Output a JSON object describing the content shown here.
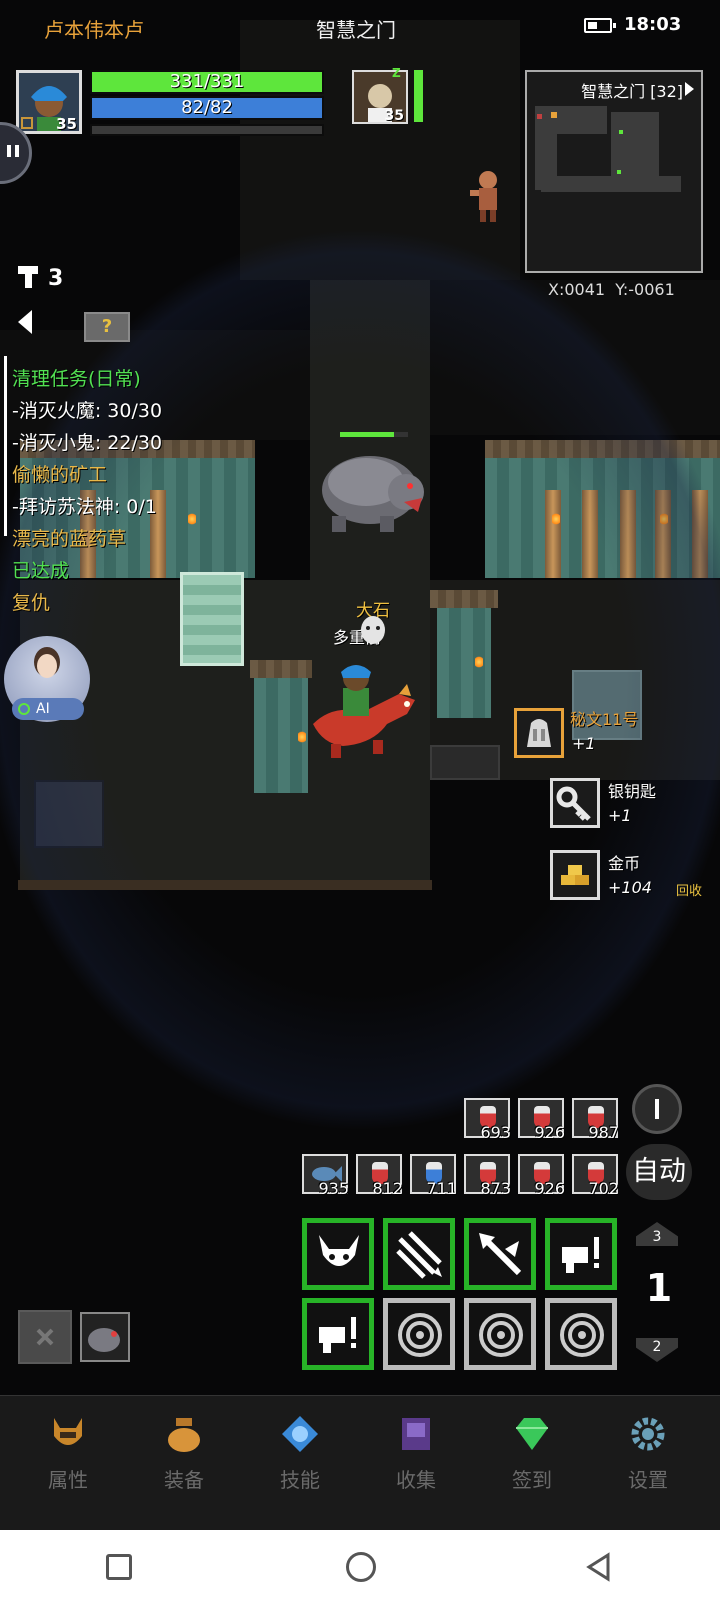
{
  "header": {
    "player_name": "卢本伟本卢",
    "zone_title": "智慧之门",
    "time": "18:03"
  },
  "player": {
    "level": "35",
    "hp_text": "331/331",
    "hp_fraction": 1.0,
    "mp_text": "82/82",
    "mp_fraction": 1.0,
    "xp_fraction": 0.0
  },
  "companion": {
    "level": "35",
    "status": "Z"
  },
  "minimap": {
    "title": "智慧之门 [32]",
    "coords": "X:0041  Y:-0061"
  },
  "keys_count": "3",
  "quests": [
    {
      "text": "清理任务(日常)",
      "color": "#52e052"
    },
    {
      "text": "-消灭火魔: 30/30",
      "color": "#ffffff"
    },
    {
      "text": "-消灭小鬼: 22/30",
      "color": "#ffffff"
    },
    {
      "text": "偷懒的矿工",
      "color": "#e8b84a"
    },
    {
      "text": "-拜访苏法神: 0/1",
      "color": "#ffffff"
    },
    {
      "text": "漂亮的蓝药草",
      "color": "#e8b84a"
    },
    {
      "text": "已达成",
      "color": "#52e052"
    },
    {
      "text": "复仇",
      "color": "#e8b84a"
    }
  ],
  "ai_badge": "AI",
  "world_labels": {
    "npc_name": "大石",
    "npc_sub": "多重箭"
  },
  "loot": [
    {
      "name": "秘文11号",
      "amount": "+1",
      "color": "#e8a23a"
    },
    {
      "name": "银钥匙",
      "amount": "+1",
      "color": "#ffffff"
    },
    {
      "name": "金币",
      "amount": "+104",
      "color": "#ffffff"
    }
  ],
  "recycle_label": "回收",
  "quickbar_row1": [
    "693",
    "926",
    "987"
  ],
  "quickbar_row2": [
    "935",
    "812",
    "711",
    "873",
    "926",
    "702"
  ],
  "auto_label": "自动",
  "page": {
    "current": "1",
    "up": "3",
    "down": "2"
  },
  "nav": [
    {
      "label": "属性",
      "icon": "helmet-icon"
    },
    {
      "label": "装备",
      "icon": "bag-icon"
    },
    {
      "label": "技能",
      "icon": "skill-gem-icon"
    },
    {
      "label": "收集",
      "icon": "book-icon"
    },
    {
      "label": "签到",
      "icon": "emerald-icon"
    },
    {
      "label": "设置",
      "icon": "gear-icon"
    }
  ],
  "colors": {
    "hp": "#5ee63c",
    "mp": "#3d7fd8",
    "skill_border": "#27b327",
    "accent_orange": "#e8a23a"
  }
}
